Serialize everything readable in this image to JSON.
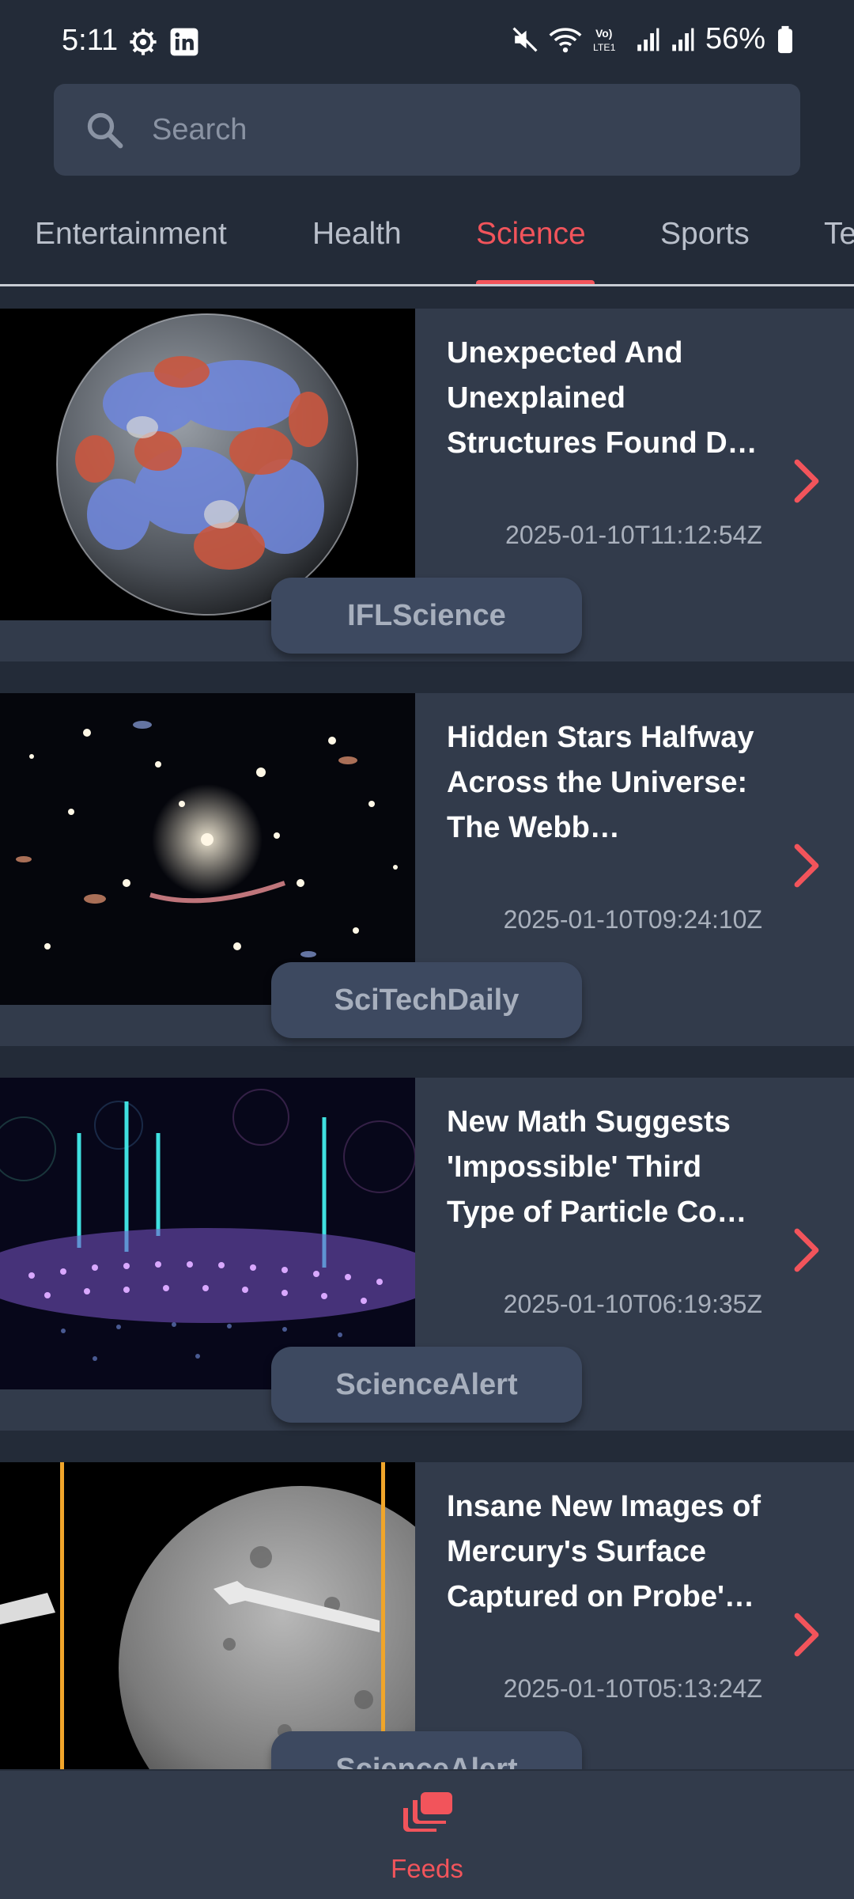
{
  "status_bar": {
    "time": "5:11",
    "battery": "56%",
    "icons": [
      "settings-gear-icon",
      "linkedin-icon",
      "mute-icon",
      "wifi-icon",
      "volte-icon",
      "signal-icon",
      "signal-icon",
      "battery-icon"
    ]
  },
  "search": {
    "placeholder": "Search"
  },
  "tabs": [
    {
      "label": "Entertainment",
      "active": false
    },
    {
      "label": "Health",
      "active": false
    },
    {
      "label": "Science",
      "active": true
    },
    {
      "label": "Sports",
      "active": false
    },
    {
      "label": "Te",
      "active": false
    }
  ],
  "articles": [
    {
      "title": "Unexpected And Unexplained Structures Found D…",
      "date": "2025-01-10T11:12:54Z",
      "source": "IFLScience",
      "thumbnail": "earth-globe-structures"
    },
    {
      "title": "Hidden Stars Halfway Across the Universe: The Webb…",
      "date": "2025-01-10T09:24:10Z",
      "source": "SciTechDaily",
      "thumbnail": "galaxy-cluster"
    },
    {
      "title": "New Math Suggests 'Impossible' Third Type of Particle Co…",
      "date": "2025-01-10T06:19:35Z",
      "source": "ScienceAlert",
      "thumbnail": "particle-grid"
    },
    {
      "title": "Insane New Images of Mercury's Surface Captured on Probe'…",
      "date": "2025-01-10T05:13:24Z",
      "source": "ScienceAlert",
      "thumbnail": "mercury-probe"
    }
  ],
  "bottom_nav": {
    "label": "Feeds",
    "icon": "feeds-stack-icon"
  },
  "colors": {
    "accent": "#f2545b",
    "background": "#232b38",
    "card": "#323b4b"
  }
}
